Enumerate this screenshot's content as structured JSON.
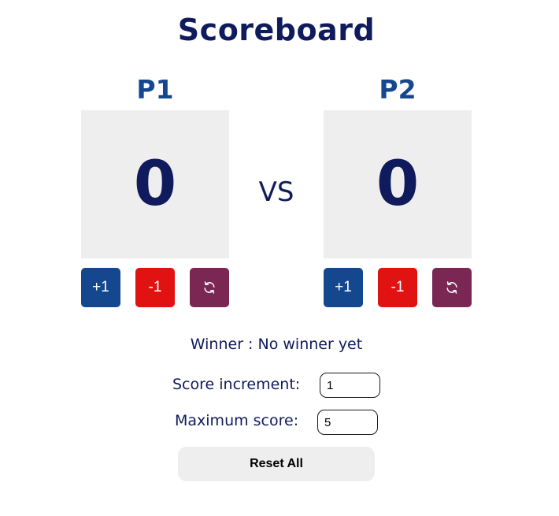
{
  "title": "Scoreboard",
  "vs_label": "VS",
  "players": [
    {
      "name": "P1",
      "score": "0",
      "increment_label": "+1",
      "decrement_label": "-1",
      "reset_icon": "refresh-icon"
    },
    {
      "name": "P2",
      "score": "0",
      "increment_label": "+1",
      "decrement_label": "-1",
      "reset_icon": "refresh-icon"
    }
  ],
  "winner": {
    "text": "Winner : No winner yet"
  },
  "settings": {
    "increment_label": "Score increment:",
    "increment_value": "1",
    "max_label": "Maximum score:",
    "max_value": "5"
  },
  "reset_all_label": "Reset All",
  "colors": {
    "heading": "#0f1b5c",
    "player_name": "#15478f",
    "plus_button": "#15478f",
    "minus_button": "#e01212",
    "reset_button": "#7a2853",
    "score_box": "#eeeeee"
  }
}
